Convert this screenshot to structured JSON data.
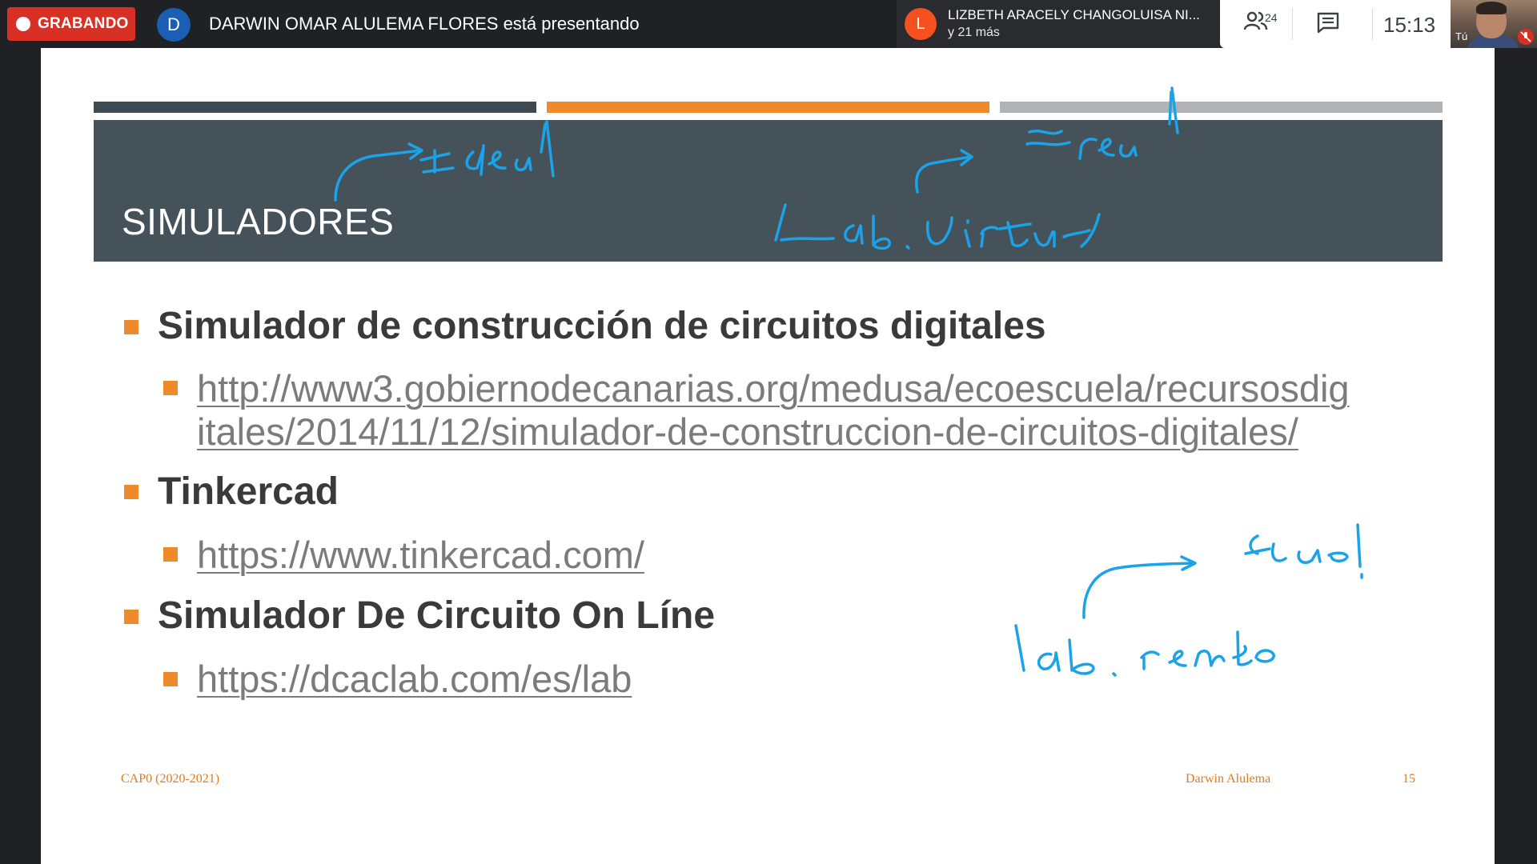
{
  "topbar": {
    "recording_label": "GRABANDO",
    "presenter_initial": "D",
    "presenter_text": "DARWIN OMAR ALULEMA FLORES está presentando",
    "participant": {
      "initial": "L",
      "name": "LIZBETH ARACELY CHANGOLUISA NI...",
      "more": "y 21 más"
    },
    "people_count": "24",
    "clock": "15:13",
    "self_label": "Tú",
    "icons": [
      "people-icon",
      "chat-icon",
      "mic-off-icon"
    ]
  },
  "slide": {
    "title": "SIMULADORES",
    "bullets": [
      {
        "text": "Simulador de construcción de circuitos digitales",
        "link_line1": "http://www3.gobiernodecanarias.org/medusa/ecoescuela/recursosdig",
        "link_line2": "itales/2014/11/12/simulador-de-construccion-de-circuitos-digitales/"
      },
      {
        "text": "Tinkercad",
        "link_line1": "https://www.tinkercad.com/"
      },
      {
        "text": "Simulador De Circuito On Líne",
        "link_line1": "https://dcaclab.com/es/lab"
      }
    ],
    "footer_left": "CAP0 (2020-2021)",
    "footer_author": "Darwin Alulema",
    "page_number": "15"
  },
  "colors": {
    "recording_red": "#d93025",
    "slide_accent": "#ee8a2b",
    "title_band": "#465259",
    "ink_blue": "#1aa3e8"
  }
}
